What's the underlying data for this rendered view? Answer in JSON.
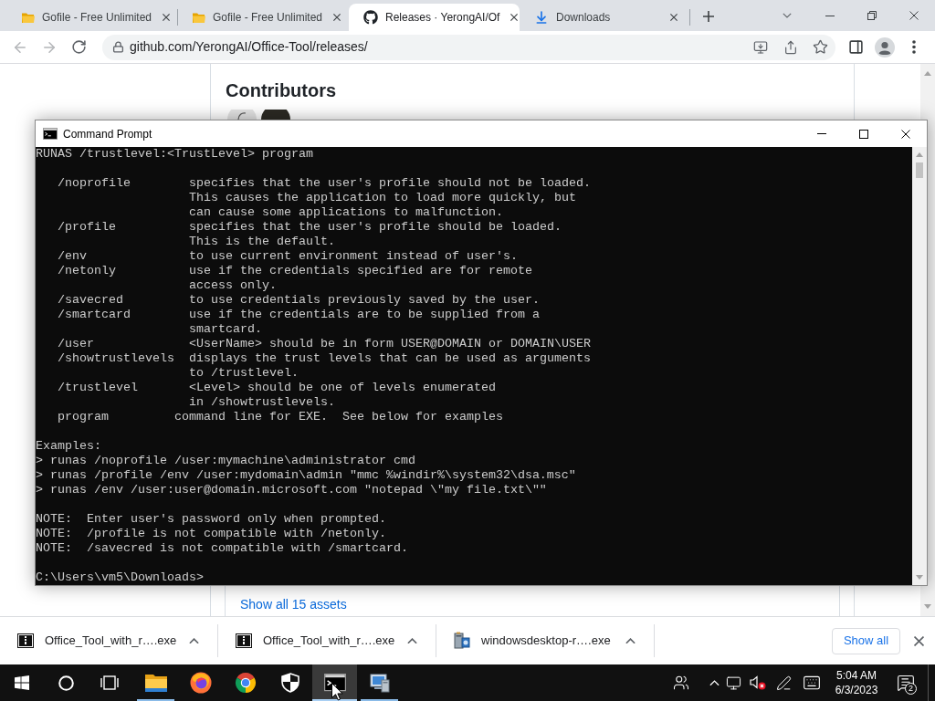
{
  "browser": {
    "tabs": [
      {
        "kind": "folder",
        "title": "Gofile - Free Unlimited",
        "selected": false
      },
      {
        "kind": "folder",
        "title": "Gofile - Free Unlimited",
        "selected": false
      },
      {
        "kind": "github",
        "title": "Releases · YerongAI/Of",
        "selected": true
      },
      {
        "kind": "download",
        "title": "Downloads",
        "selected": false
      }
    ],
    "navigation": {
      "back": {
        "disabled": true
      },
      "forward": {
        "disabled": true
      }
    },
    "address": "github.com/YerongAI/Office-Tool/releases/"
  },
  "page": {
    "heading": "Contributors",
    "assets_link": "Show all 15 assets"
  },
  "cmd": {
    "title": "Command Prompt",
    "sections": [
      {
        "kind": "lines",
        "lines": [
          "RUNAS /trustlevel:<TrustLevel> program"
        ]
      },
      {
        "kind": "options",
        "items": [
          {
            "kind": "switch",
            "name": "/noprofile",
            "description": [
              "specifies that the user's profile should not be loaded.",
              "This causes the application to load more quickly, but",
              "can cause some applications to malfunction."
            ]
          },
          {
            "kind": "switch",
            "name": "/profile",
            "description": [
              "specifies that the user's profile should be loaded.",
              "This is the default."
            ]
          },
          {
            "kind": "switch",
            "name": "/env",
            "description": [
              "to use current environment instead of user's."
            ]
          },
          {
            "kind": "switch",
            "name": "/netonly",
            "description": [
              "use if the credentials specified are for remote",
              "access only."
            ]
          },
          {
            "kind": "switch",
            "name": "/savecred",
            "description": [
              "to use credentials previously saved by the user."
            ]
          },
          {
            "kind": "switch",
            "name": "/smartcard",
            "description": [
              "use if the credentials are to be supplied from a",
              "smartcard."
            ]
          },
          {
            "kind": "switch",
            "name": "/user",
            "description": [
              "<UserName> should be in form USER@DOMAIN or DOMAIN\\USER"
            ]
          },
          {
            "kind": "switch",
            "name": "/showtrustlevels",
            "description": [
              "displays the trust levels that can be used as arguments",
              "to /trustlevel."
            ]
          },
          {
            "kind": "switch",
            "name": "/trustlevel",
            "description": [
              "<Level> should be one of levels enumerated",
              "in /showtrustlevels."
            ]
          },
          {
            "kind": "argument",
            "name": "program",
            "description": [
              "command line for EXE.  See below for examples"
            ]
          }
        ]
      },
      {
        "kind": "lines",
        "lines": [
          "Examples:",
          "> runas /noprofile /user:mymachine\\administrator cmd",
          "> runas /profile /env /user:mydomain\\admin \"mmc %windir%\\system32\\dsa.msc\"",
          "> runas /env /user:user@domain.microsoft.com \"notepad \\\"my file.txt\\\"\""
        ]
      },
      {
        "kind": "lines",
        "lines": [
          "NOTE:  Enter user's password only when prompted.",
          "NOTE:  /profile is not compatible with /netonly.",
          "NOTE:  /savecred is not compatible with /smartcard."
        ]
      },
      {
        "kind": "lines",
        "lines": [
          "C:\\Users\\vm5\\Downloads>"
        ]
      }
    ]
  },
  "downloads": {
    "items": [
      {
        "kind": "archive",
        "name": "Office_Tool_with_r….exe"
      },
      {
        "kind": "archive",
        "name": "Office_Tool_with_r….exe"
      },
      {
        "kind": "installer",
        "name": "windowsdesktop-r….exe"
      }
    ],
    "show_all": "Show all"
  },
  "taskbar": {
    "apps": [
      {
        "kind": "file-explorer",
        "running": true,
        "selected": false
      },
      {
        "kind": "firefox",
        "running": false,
        "selected": false
      },
      {
        "kind": "chrome",
        "running": false,
        "selected": false
      },
      {
        "kind": "security",
        "running": false,
        "selected": false
      },
      {
        "kind": "console",
        "running": true,
        "selected": true
      },
      {
        "kind": "control-panel",
        "running": true,
        "selected": false
      }
    ],
    "clock": {
      "time": "5:04 AM",
      "date": "6/3/2023"
    },
    "notifications": "2"
  }
}
